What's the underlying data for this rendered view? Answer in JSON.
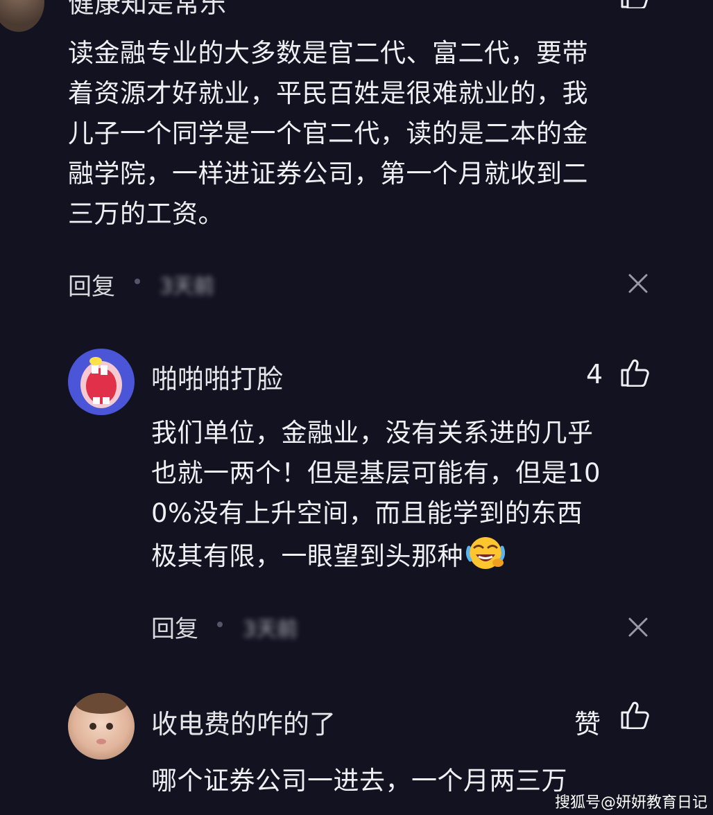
{
  "comments": [
    {
      "author": "健康知是常乐",
      "text_lines": [
        "读金融专业的大多数是官二代、富二代，要带",
        "着资源才好就业，平民百姓是很难就业的，我",
        "儿子一个同学是一个官二代，读的是二本的金",
        "融学院，一样进证券公司，第一个月就收到二",
        "三万的工资。"
      ],
      "reply_label": "回复",
      "time": "3天前",
      "avatar_icon": "user-avatar-partial"
    },
    {
      "author": "啪啪啪打脸",
      "likes": "4",
      "text_lines": [
        "我们单位，金融业，没有关系进的几乎",
        "也就一两个！但是基层可能有，但是10",
        "0%没有上升空间，而且能学到的东西",
        "极其有限，一眼望到头那种"
      ],
      "emoji": "laughing-crying-emoji",
      "reply_label": "回复",
      "time": "3天前",
      "avatar_icon": "cartoon-mouth-avatar",
      "avatar_color": "#4a55d8"
    },
    {
      "author": "收电费的咋的了",
      "likes": "赞",
      "text_lines": [
        "哪个证券公司一进去，一个月两三万"
      ],
      "avatar_icon": "baby-photo-avatar"
    }
  ],
  "watermark": "搜狐号@妍妍教育日记"
}
